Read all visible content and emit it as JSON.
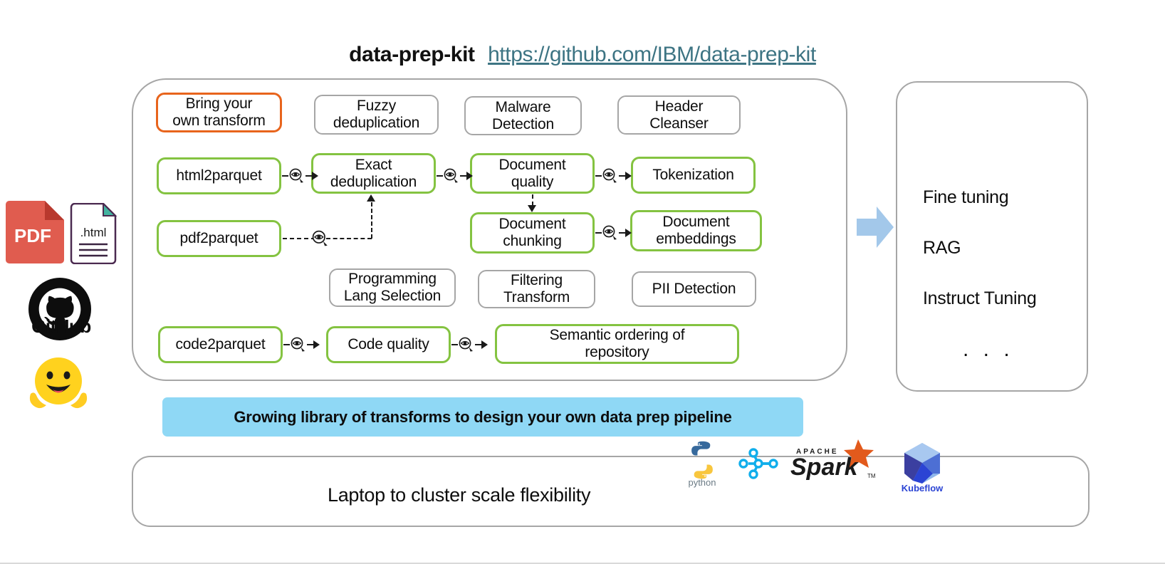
{
  "header": {
    "title": "data-prep-kit",
    "url": "https://github.com/IBM/data-prep-kit"
  },
  "sources": {
    "pdf_label": "PDF",
    "html_label": ".html",
    "github_label": "GitHub",
    "huggingface_label": "hugging-face-emoji"
  },
  "pipeline": {
    "boxes": [
      {
        "id": "bring-your-own-transform",
        "label": "Bring your\nown transform",
        "style": "orange"
      },
      {
        "id": "fuzzy-deduplication",
        "label": "Fuzzy\ndeduplication",
        "style": "grey"
      },
      {
        "id": "malware-detection",
        "label": "Malware\nDetection",
        "style": "grey"
      },
      {
        "id": "header-cleanser",
        "label": "Header\nCleanser",
        "style": "grey"
      },
      {
        "id": "html2parquet",
        "label": "html2parquet",
        "style": "green"
      },
      {
        "id": "exact-deduplication",
        "label": "Exact\ndeduplication",
        "style": "green"
      },
      {
        "id": "document-quality",
        "label": "Document\nquality",
        "style": "green"
      },
      {
        "id": "tokenization",
        "label": "Tokenization",
        "style": "green"
      },
      {
        "id": "pdf2parquet",
        "label": "pdf2parquet",
        "style": "green"
      },
      {
        "id": "document-chunking",
        "label": "Document\nchunking",
        "style": "green"
      },
      {
        "id": "document-embeddings",
        "label": "Document\nembeddings",
        "style": "green"
      },
      {
        "id": "programming-lang-selection",
        "label": "Programming\nLang Selection",
        "style": "grey"
      },
      {
        "id": "filtering-transform",
        "label": "Filtering\nTransform",
        "style": "grey"
      },
      {
        "id": "pii-detection",
        "label": "PII Detection",
        "style": "grey"
      },
      {
        "id": "code2parquet",
        "label": "code2parquet",
        "style": "green"
      },
      {
        "id": "code-quality",
        "label": "Code quality",
        "style": "green"
      },
      {
        "id": "semantic-ordering",
        "label": "Semantic ordering of\nrepository",
        "style": "green"
      }
    ],
    "connector_icon": "eye-magnifier-icon",
    "banner": "Growing library of transforms to design your own data prep pipeline"
  },
  "outcomes": {
    "items": [
      "Fine tuning",
      "RAG",
      "Instruct Tuning"
    ],
    "ellipsis": ". . ."
  },
  "scale": {
    "label": "Laptop to cluster scale flexibility",
    "logos": [
      {
        "id": "python-logo",
        "caption": "python"
      },
      {
        "id": "ray-logo",
        "caption": ""
      },
      {
        "id": "spark-logo",
        "caption": ""
      },
      {
        "id": "kubeflow-logo",
        "caption": "Kubeflow"
      }
    ],
    "spark_top_text": "APACHE",
    "spark_text": "Spark"
  },
  "colors": {
    "green_border": "#84c341",
    "grey_border": "#a6a6a6",
    "orange_border": "#e8641c",
    "banner_blue": "#8fd8f5",
    "arrow_blue": "#a3c8ea",
    "url_teal": "#3d7483",
    "pdf_red": "#e05c4f",
    "kubeflow_blue": "#2b44d4"
  }
}
